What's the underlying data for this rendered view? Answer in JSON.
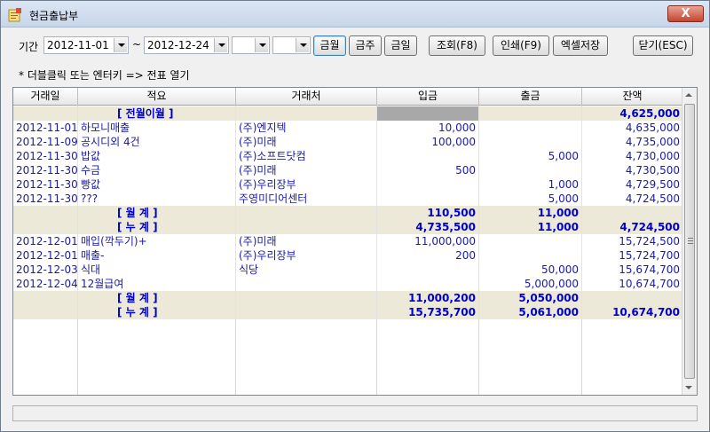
{
  "window": {
    "title": "현금출납부",
    "close_label": "X"
  },
  "toolbar": {
    "period_label": "기간",
    "date_from": "2012-11-01",
    "tilde": "~",
    "date_to": "2012-12-24",
    "combo3": "",
    "combo4": "",
    "btn_month": "금월",
    "btn_week": "금주",
    "btn_day": "금일",
    "btn_query": "조회(F8)",
    "btn_print": "인쇄(F9)",
    "btn_excel": "엑셀저장",
    "btn_close": "닫기(ESC)"
  },
  "hint": "* 더블클릭 또는 엔터키 => 전표 열기",
  "table": {
    "columns": [
      "거래일",
      "적요",
      "거래처",
      "입금",
      "출금",
      "잔액"
    ],
    "rows": [
      {
        "type": "sum",
        "date": "",
        "memo": "[ 전월이월 ]",
        "party": "",
        "in": "",
        "out": "",
        "bal": "4,625,000",
        "gray": true
      },
      {
        "type": "data",
        "date": "2012-11-01",
        "memo": "하모니매출",
        "party": "(주)엔지텍",
        "in": "10,000",
        "out": "",
        "bal": "4,635,000"
      },
      {
        "type": "data",
        "date": "2012-11-09",
        "memo": "공시디외 4건",
        "party": "(주)미래",
        "in": "100,000",
        "out": "",
        "bal": "4,735,000"
      },
      {
        "type": "data",
        "date": "2012-11-30",
        "memo": "밥값",
        "party": "(주)소프트닷컴",
        "in": "",
        "out": "5,000",
        "bal": "4,730,000"
      },
      {
        "type": "data",
        "date": "2012-11-30",
        "memo": "수금",
        "party": "(주)미래",
        "in": "500",
        "out": "",
        "bal": "4,730,500"
      },
      {
        "type": "data",
        "date": "2012-11-30",
        "memo": "빵값",
        "party": "(주)우리장부",
        "in": "",
        "out": "1,000",
        "bal": "4,729,500"
      },
      {
        "type": "data",
        "date": "2012-11-30",
        "memo": "???",
        "party": "주영미디어센터",
        "in": "",
        "out": "5,000",
        "bal": "4,724,500"
      },
      {
        "type": "sum",
        "date": "",
        "memo": "[ 월    계 ]",
        "party": "",
        "in": "110,500",
        "out": "11,000",
        "bal": ""
      },
      {
        "type": "sum",
        "date": "",
        "memo": "[ 누    계 ]",
        "party": "",
        "in": "4,735,500",
        "out": "11,000",
        "bal": "4,724,500"
      },
      {
        "type": "data",
        "date": "2012-12-01",
        "memo": "매입(깍두기)+",
        "party": "(주)미래",
        "in": "11,000,000",
        "out": "",
        "bal": "15,724,500"
      },
      {
        "type": "data",
        "date": "2012-12-01",
        "memo": "매출-",
        "party": "(주)우리장부",
        "in": "200",
        "out": "",
        "bal": "15,724,700"
      },
      {
        "type": "data",
        "date": "2012-12-03",
        "memo": "식대",
        "party": "식당",
        "in": "",
        "out": "50,000",
        "bal": "15,674,700"
      },
      {
        "type": "data",
        "date": "2012-12-04",
        "memo": "12월급여",
        "party": "",
        "in": "",
        "out": "5,000,000",
        "bal": "10,674,700"
      },
      {
        "type": "sum",
        "date": "",
        "memo": "[ 월    계 ]",
        "party": "",
        "in": "11,000,200",
        "out": "5,050,000",
        "bal": ""
      },
      {
        "type": "sum",
        "date": "",
        "memo": "[ 누    계 ]",
        "party": "",
        "in": "15,735,700",
        "out": "5,061,000",
        "bal": "10,674,700"
      }
    ]
  },
  "colors": {
    "text_blue": "#1a1aa8",
    "summary_bg": "#ece9d8",
    "summary_text": "#0000cc"
  }
}
